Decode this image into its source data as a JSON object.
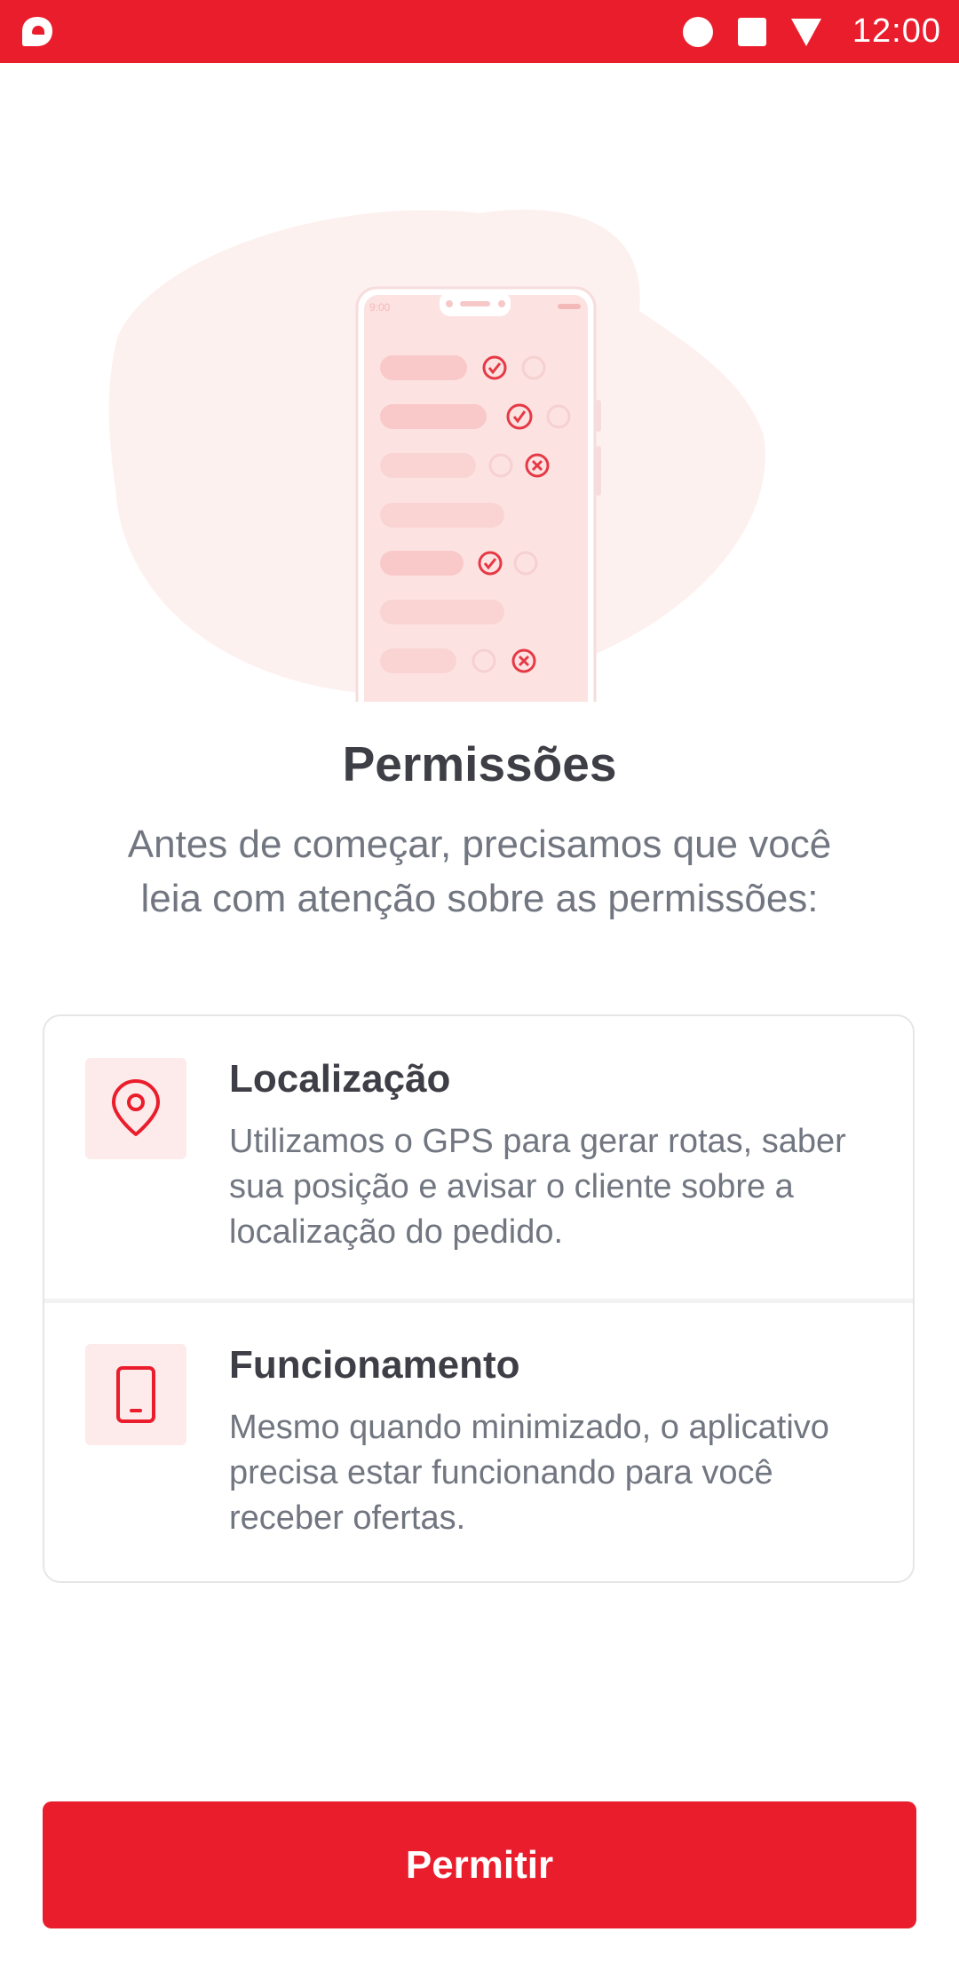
{
  "status_bar": {
    "time": "12:00",
    "icons": [
      "app-logo-icon",
      "circle-notification-icon",
      "square-notification-icon",
      "signal-icon"
    ]
  },
  "illustration": {
    "phone_time": "9:00",
    "icon": "phone-permissions-illustration"
  },
  "page": {
    "title": "Permissões",
    "subtitle": "Antes de começar, precisamos que você leia com atenção sobre as permissões:"
  },
  "permissions": [
    {
      "icon": "location-pin-icon",
      "title": "Localização",
      "description": "Utilizamos o GPS para gerar rotas, saber sua posição e avisar o cliente sobre a localização do pedido."
    },
    {
      "icon": "smartphone-icon",
      "title": "Funcionamento",
      "description": "Mesmo quando minimizado, o aplicativo precisa estar funcionando para você receber ofertas."
    }
  ],
  "action": {
    "button_label": "Permitir"
  },
  "colors": {
    "brand": "#ea1d2c",
    "icon_bg": "#fdeaea",
    "title_text": "#3e3e46",
    "body_text": "#717680"
  }
}
